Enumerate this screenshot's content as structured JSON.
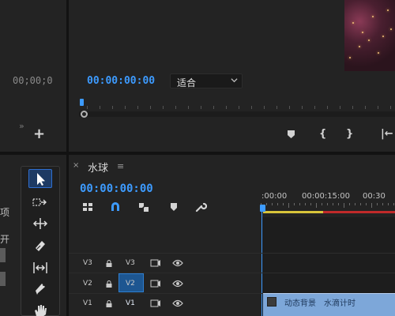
{
  "source_monitor": {
    "timecode": "00;00;0"
  },
  "program_monitor": {
    "timecode": "00:00:00:00",
    "fit_dropdown": {
      "selected": "适合"
    },
    "controls": [
      "{",
      "}",
      "|←"
    ]
  },
  "timeline": {
    "sequence_name": "水球",
    "timecode": "00:00:00:00",
    "ruler_labels": [
      ":00:00",
      "00:00:15:00",
      "00:30"
    ],
    "tracks": [
      {
        "target": "V3",
        "name": "V3"
      },
      {
        "target": "V2",
        "name": "V2"
      },
      {
        "target": "V1",
        "name": "V1"
      }
    ],
    "clip_text": "动态背景　水滴计时"
  },
  "project_panel": {
    "text_1": "项",
    "text_2": "开"
  },
  "colors": {
    "accent_blue": "#3d9bff",
    "work_area_yellow": "#d8c43a",
    "work_area_red": "#c12a2a",
    "clip_blue": "#7da7d9"
  }
}
